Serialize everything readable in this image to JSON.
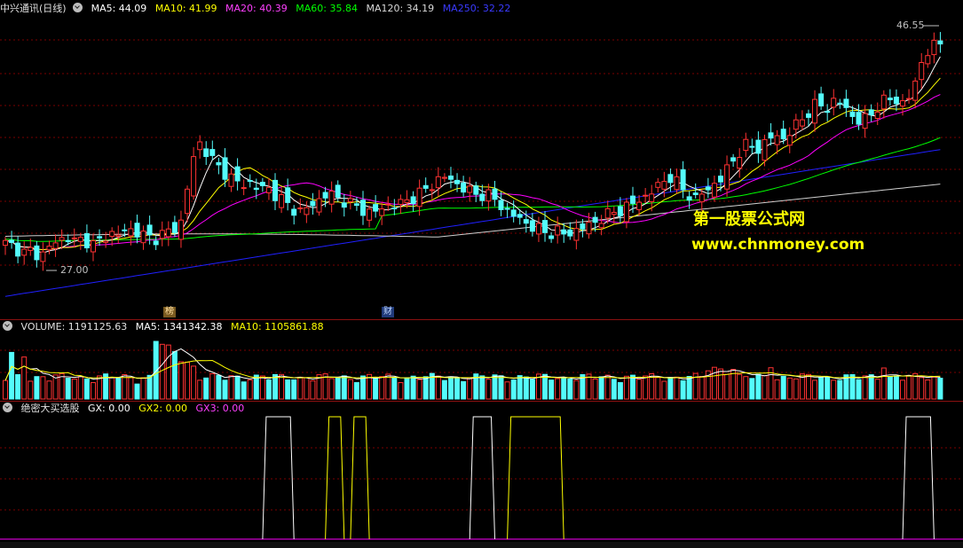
{
  "main_header": {
    "title": "中兴通讯(日线)",
    "ma5": "MA5: 44.09",
    "ma10": "MA10: 41.99",
    "ma20": "MA20: 40.39",
    "ma60": "MA60: 35.84",
    "ma120": "MA120: 34.19",
    "ma250": "MA250: 32.22"
  },
  "price_labels": {
    "high": "46.55",
    "low": "27.00"
  },
  "event_tags": {
    "bang": "榜",
    "cai": "财"
  },
  "watermark": {
    "line1": "第一股票公式网",
    "line2": "www.chnmoney.com"
  },
  "volume_header": {
    "volume": "VOLUME: 1191125.63",
    "ma5": "MA5: 1341342.38",
    "ma10": "MA10: 1105861.88"
  },
  "indicator_header": {
    "name": "绝密大买选股",
    "gx": "GX: 0.00",
    "gx2": "GX2: 0.00",
    "gx3": "GX3: 0.00"
  },
  "colors": {
    "up": "#ff3232",
    "down": "#54fcfc",
    "ma5": "#ffffff",
    "ma10": "#ffff00",
    "ma20": "#ff00ff",
    "ma60": "#00ff00",
    "ma120": "#d0d0d0",
    "ma250": "#2020ff",
    "grid": "#7a0000",
    "white_line": "#ffffff",
    "yellow_line": "#ffff00",
    "magenta_base": "#ff00ff"
  },
  "chart_data": {
    "type": "candlestick",
    "price_range": [
      24,
      48
    ],
    "closes": [
      29.2,
      29.0,
      28.4,
      28.6,
      28.1,
      28.9,
      29.4,
      29.8,
      29.3,
      29.6,
      29.1,
      29.5,
      30.1,
      29.9,
      30.4,
      30.2,
      29.8,
      29.6,
      30.0,
      30.3,
      30.6,
      34.5,
      37.8,
      36.9,
      35.8,
      35.2,
      34.6,
      34.0,
      34.3,
      33.7,
      33.9,
      33.2,
      32.6,
      32.1,
      31.8,
      32.4,
      32.9,
      33.4,
      33.0,
      32.7,
      32.3,
      32.0,
      31.7,
      32.1,
      32.5,
      32.4,
      32.8,
      33.2,
      33.6,
      34.2,
      34.8,
      34.5,
      34.0,
      33.6,
      33.2,
      33.4,
      32.8,
      32.2,
      31.6,
      31.2,
      30.7,
      30.4,
      30.0,
      30.3,
      29.9,
      30.2,
      30.5,
      30.8,
      31.2,
      31.6,
      31.9,
      32.2,
      32.6,
      33.0,
      33.5,
      34.2,
      34.8,
      34.1,
      33.4,
      32.9,
      33.5,
      34.1,
      34.6,
      35.9,
      36.8,
      37.5,
      37.0,
      37.6,
      38.3,
      37.9,
      38.6,
      39.5,
      40.2,
      40.9,
      40.4,
      41.2,
      40.6,
      39.8,
      39.2,
      40.0,
      40.7,
      41.3,
      41.1,
      40.8,
      42.2,
      44.8,
      45.4,
      46.0
    ],
    "volume_range": [
      0,
      2800000
    ],
    "indicator_signals": [
      {
        "series": "GX",
        "color": "white",
        "start": 41,
        "end": 46
      },
      {
        "series": "GX2",
        "color": "yellow",
        "start": 51,
        "end": 54
      },
      {
        "series": "GX2",
        "color": "yellow",
        "start": 55,
        "end": 58
      },
      {
        "series": "GX",
        "color": "white",
        "start": 74,
        "end": 78
      },
      {
        "series": "GX2",
        "color": "yellow",
        "start": 80,
        "end": 89
      },
      {
        "series": "GX",
        "color": "white",
        "start": 143,
        "end": 148
      }
    ]
  }
}
